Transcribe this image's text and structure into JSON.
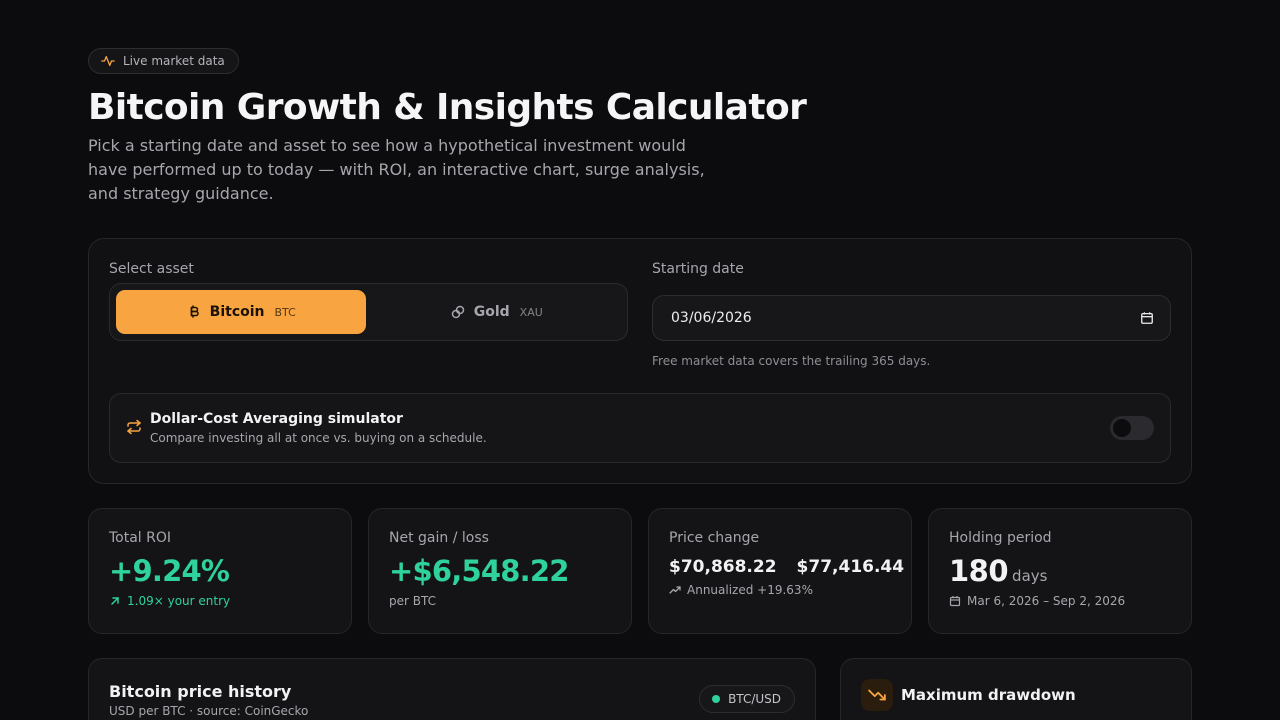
{
  "header": {
    "badge_label": "Live market data",
    "title": "Bitcoin Growth & Insights Calculator",
    "subtitle": "Pick a starting date and asset to see how a hypothetical investment would have performed up to today — with ROI, an interactive chart, surge analysis, and strategy guidance."
  },
  "asset_selector": {
    "label": "Select asset",
    "options": [
      {
        "label": "Bitcoin",
        "ticker": "BTC",
        "selected": true,
        "icon": "bitcoin-icon"
      },
      {
        "label": "Gold",
        "ticker": "XAU",
        "selected": false,
        "icon": "link-icon"
      }
    ]
  },
  "start_date": {
    "label": "Starting date",
    "value": "03/06/2026",
    "hint": "Free market data covers the trailing 365 days."
  },
  "dca": {
    "title": "Dollar-Cost Averaging simulator",
    "description": "Compare investing all at once vs. buying on a schedule.",
    "enabled": false
  },
  "stats": {
    "roi": {
      "label": "Total ROI",
      "value": "+9.24%",
      "sub": "1.09× your entry"
    },
    "net": {
      "label": "Net gain / loss",
      "value": "+$6,548.22",
      "sub": "per BTC"
    },
    "price": {
      "label": "Price change",
      "start": "$70,868.22",
      "end": "$77,416.44",
      "sub": "Annualized +19.63%"
    },
    "holding": {
      "label": "Holding period",
      "value": "180",
      "unit": "days",
      "sub": "Mar 6, 2026 – Sep 2, 2026"
    }
  },
  "chart_card": {
    "title": "Bitcoin price history",
    "subtitle": "USD per BTC · source: CoinGecko",
    "pair": "BTC/USD"
  },
  "drawdown_card": {
    "title": "Maximum drawdown"
  },
  "colors": {
    "accent": "#f7a441",
    "positive": "#2fd29a",
    "background": "#0c0c0e"
  }
}
